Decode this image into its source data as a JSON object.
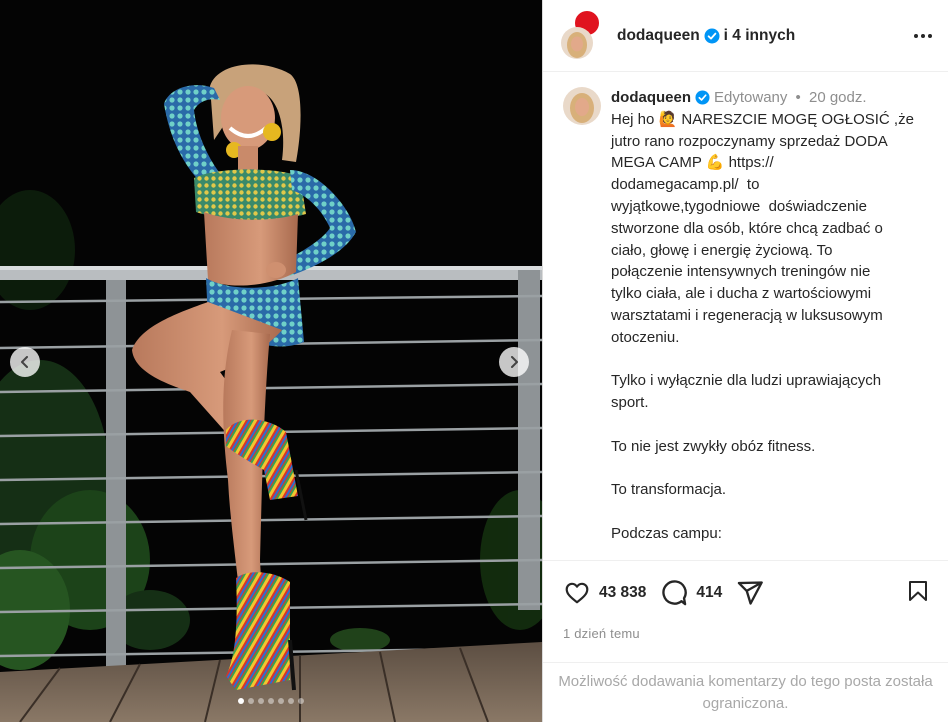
{
  "post": {
    "author": "dodaqueen",
    "collaborators_text": "i 4 innych",
    "edited_label": "Edytowany",
    "time_ago": "20 godz.",
    "caption_lines": [
      "Hej ho 🙋 NARESZCIE MOGĘ OGŁOSIĆ ,że",
      "jutro rano rozpoczynamy sprzedaż DODA",
      "MEGA CAMP 💪 https://",
      "dodamegacamp.pl/  to",
      "wyjątkowe,tygodniowe  doświadczenie",
      "stworzone dla osób, które chcą zadbać o",
      "ciało, głowę i energię życiową. To",
      "połączenie intensywnych treningów nie",
      "tylko ciała, ale i ducha z wartościowymi",
      "warsztatami i regeneracją w luksusowym",
      "otoczeniu.",
      "",
      "Tylko i wyłącznie dla ludzi uprawiających",
      "sport.",
      "",
      "To nie jest zwykły obóz fitness.",
      "",
      "To transformacja.",
      "",
      "Podczas campu:"
    ],
    "likes": "43 838",
    "comments": "414",
    "posted": "1 dzień temu",
    "comments_restricted": "Możliwość dodawania komentarzy do tego posta została ograniczona."
  },
  "carousel": {
    "slide_count": 7,
    "active_slide": 0
  },
  "icons": {
    "verified": "verified-badge-icon",
    "like": "heart-icon",
    "comment": "comment-bubble-icon",
    "share": "paper-plane-icon",
    "save": "bookmark-icon",
    "more": "more-options-icon",
    "prev": "chevron-left-icon",
    "next": "chevron-right-icon"
  },
  "colors": {
    "verified_blue": "#0095f6",
    "collab_badge": "#e0131f",
    "muted_text": "#8e8e8e"
  }
}
